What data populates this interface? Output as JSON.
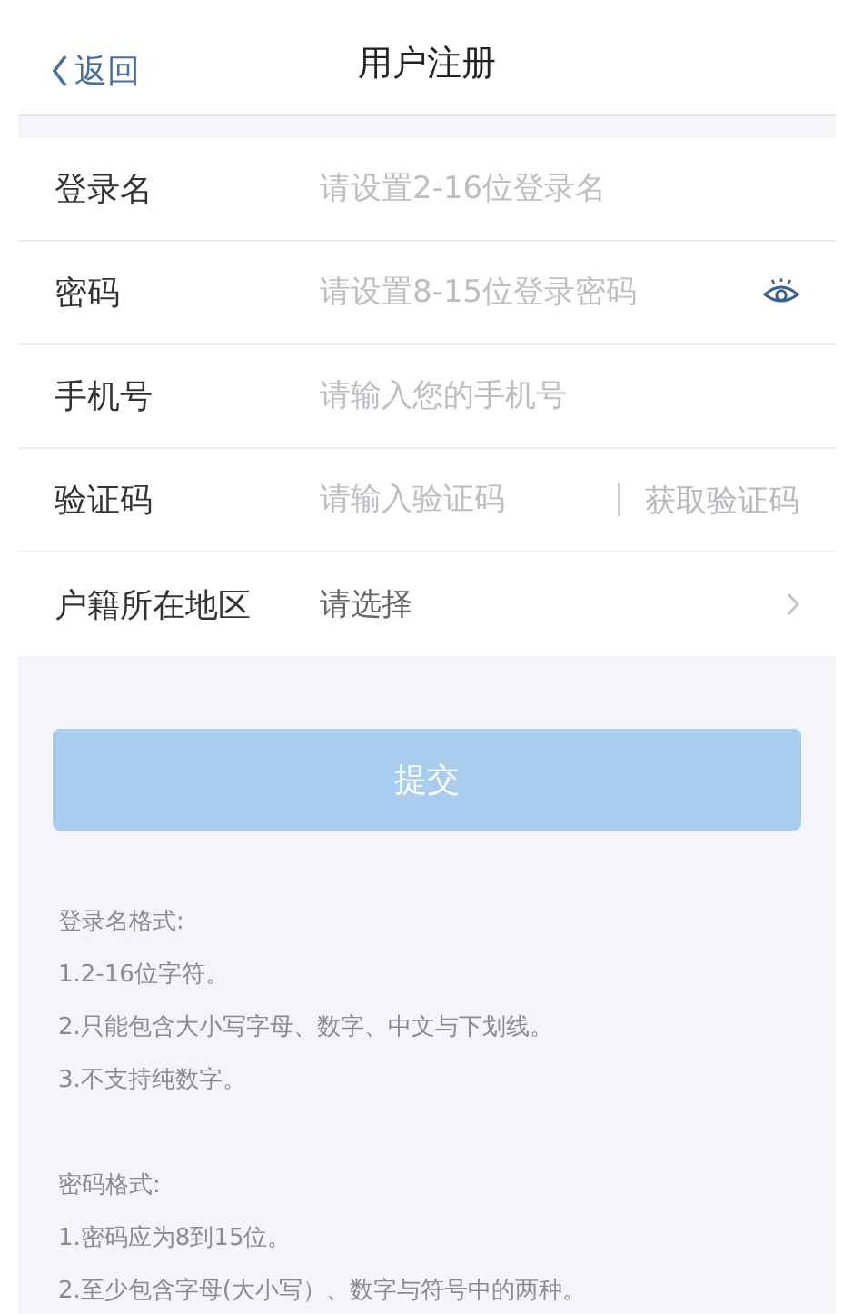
{
  "header": {
    "back": "返回",
    "title": "用户注册"
  },
  "fields": [
    {
      "kind": "text",
      "label": "登录名",
      "placeholder": "请设置2-16位登录名"
    },
    {
      "kind": "password",
      "label": "密码",
      "placeholder": "请设置8-15位登录密码"
    },
    {
      "kind": "text",
      "label": "手机号",
      "placeholder": "请输入您的手机号"
    },
    {
      "kind": "code",
      "label": "验证码",
      "placeholder": "请输入验证码",
      "action": "获取验证码"
    },
    {
      "kind": "select",
      "label": "户籍所在地区",
      "value": "请选择"
    }
  ],
  "submit": {
    "label": "提交",
    "disabled": true
  },
  "notes": [
    {
      "title": "登录名格式:",
      "lines": [
        "1.2-16位字符。",
        "2.只能包含大小写字母、数字、中文与下划线。",
        "3.不支持纯数字。"
      ]
    },
    {
      "title": "密码格式:",
      "lines": [
        "1.密码应为8到15位。",
        "2.至少包含字母(大小写）、数字与符号中的两种。"
      ]
    }
  ]
}
